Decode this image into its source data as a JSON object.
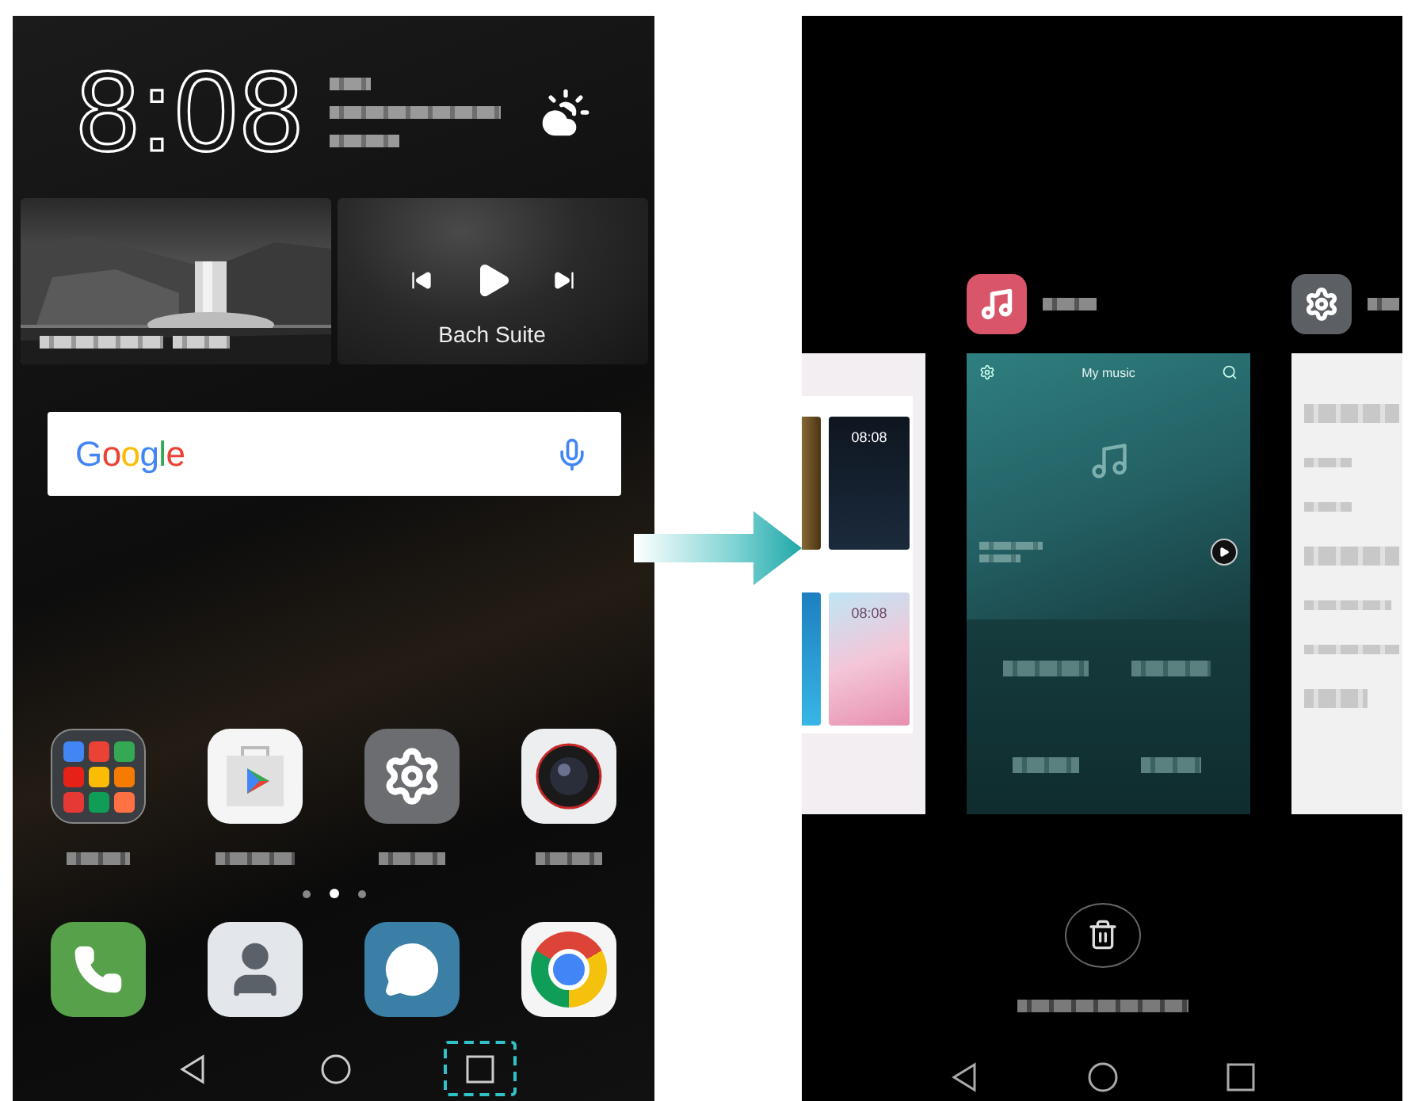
{
  "home_screen": {
    "clock": {
      "time": "8:08"
    },
    "music_widget": {
      "track": "Bach Suite"
    },
    "search_bar": {
      "logo": "Google"
    },
    "page_dots": [
      {
        "selected": false
      },
      {
        "selected": true
      },
      {
        "selected": false
      }
    ],
    "nav_bar": [
      {
        "kind": "back",
        "highlighted": false
      },
      {
        "kind": "home",
        "highlighted": false
      },
      {
        "kind": "recents",
        "highlighted": true
      }
    ]
  },
  "recent_apps": {
    "cards": [
      {
        "kind": "themes",
        "thumbnail_times": [
          "08:08",
          "08:08"
        ]
      },
      {
        "kind": "music",
        "title": "My music"
      },
      {
        "kind": "settings"
      }
    ]
  }
}
